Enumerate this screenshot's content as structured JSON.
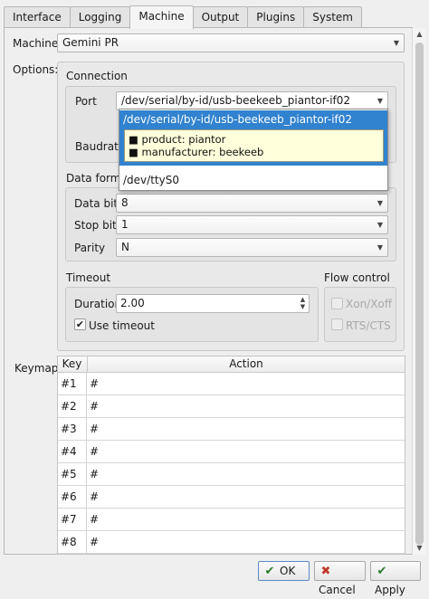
{
  "tabs": [
    "Interface",
    "Logging",
    "Machine",
    "Output",
    "Plugins",
    "System"
  ],
  "active_tab": "Machine",
  "machine": {
    "label": "Machine:",
    "value": "Gemini PR"
  },
  "options_label": "Options:",
  "connection": {
    "title": "Connection",
    "port_label": "Port",
    "port_value": "/dev/serial/by-id/usb-beekeeb_piantor-if02",
    "baudrate_label": "Baudrate",
    "dropdown": {
      "items": [
        "/dev/serial/by-id/usb-beekeeb_piantor-if02",
        "/dev/ttyS0"
      ],
      "tooltip": [
        "■ product: piantor",
        "■ manufacturer: beekeeb"
      ]
    }
  },
  "data_format": {
    "title": "Data format",
    "data_bits_label": "Data bits",
    "data_bits_value": "8",
    "stop_bits_label": "Stop bits",
    "stop_bits_value": "1",
    "parity_label": "Parity",
    "parity_value": "N"
  },
  "timeout": {
    "title": "Timeout",
    "duration_label": "Duration",
    "duration_value": "2.00",
    "use_timeout_label": "Use timeout",
    "use_timeout_checked": true
  },
  "flow_control": {
    "title": "Flow control",
    "xon_label": "Xon/Xoff",
    "rts_label": "RTS/CTS"
  },
  "keymap": {
    "label": "Keymap:",
    "columns": [
      "Key",
      "Action"
    ],
    "rows": [
      [
        "#1",
        "#"
      ],
      [
        "#2",
        "#"
      ],
      [
        "#3",
        "#"
      ],
      [
        "#4",
        "#"
      ],
      [
        "#5",
        "#"
      ],
      [
        "#6",
        "#"
      ],
      [
        "#7",
        "#"
      ],
      [
        "#8",
        "#"
      ]
    ]
  },
  "buttons": {
    "ok": "OK",
    "cancel": "Cancel",
    "apply": "Apply"
  },
  "icons": {
    "ok": "check-icon",
    "cancel": "cancel-icon",
    "apply": "apply-icon"
  },
  "colors": {
    "selection": "#3182cf",
    "tooltip_bg": "#ffffdc",
    "window_bg": "#efefef"
  }
}
